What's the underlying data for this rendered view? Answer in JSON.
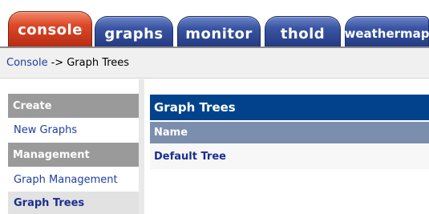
{
  "tabs": [
    {
      "label": "console",
      "active": true
    },
    {
      "label": "graphs",
      "active": false
    },
    {
      "label": "monitor",
      "active": false
    },
    {
      "label": "thold",
      "active": false
    },
    {
      "label": "weathermap",
      "active": false
    }
  ],
  "breadcrumb": {
    "link": "Console",
    "separator": "->",
    "current": "Graph Trees"
  },
  "sidebar": {
    "sections": [
      {
        "header": "Create",
        "items": [
          {
            "label": "New Graphs"
          }
        ]
      },
      {
        "header": "Management",
        "items": [
          {
            "label": "Graph Management"
          },
          {
            "label": "Graph Trees",
            "selected": true
          }
        ]
      }
    ]
  },
  "main": {
    "title": "Graph Trees",
    "columns": [
      "Name"
    ],
    "rows": [
      {
        "name": "Default Tree"
      }
    ]
  },
  "colors": {
    "active_tab": "#db4a2a",
    "inactive_tab": "#3a55a3",
    "panel_title_bg": "#00438c",
    "column_header_bg": "#7b8ead",
    "menu_header_bg": "#9a9a9a",
    "link": "#1f3da0"
  }
}
